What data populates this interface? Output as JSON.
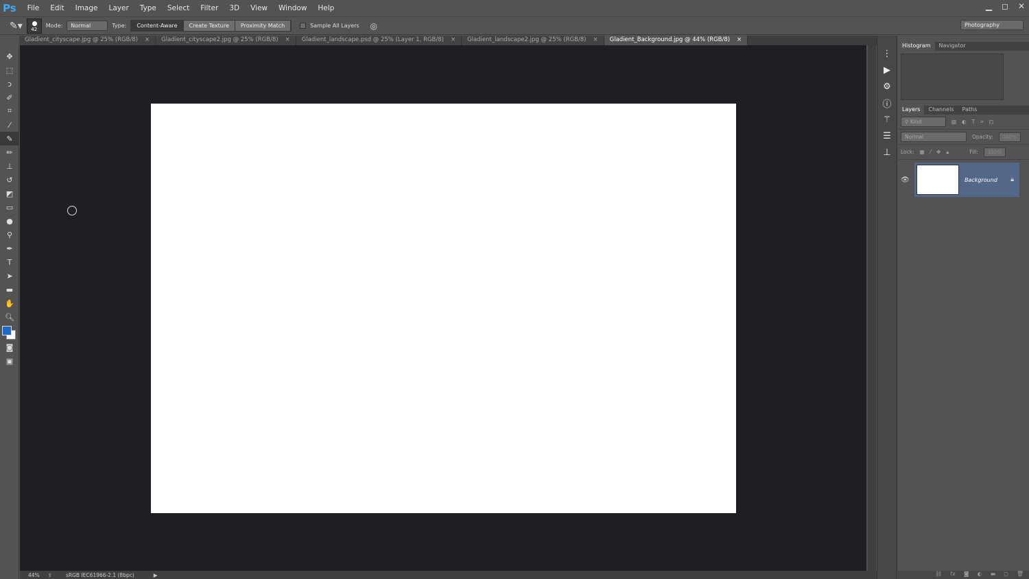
{
  "app": {
    "logo": "Ps"
  },
  "menu": [
    "File",
    "Edit",
    "Image",
    "Layer",
    "Type",
    "Select",
    "Filter",
    "3D",
    "View",
    "Window",
    "Help"
  ],
  "window_controls": {
    "minimize": "▁",
    "restore": "◻",
    "close": "✕"
  },
  "options": {
    "brush_size": "42",
    "mode_label": "Mode:",
    "mode_value": "Normal",
    "type_label": "Type:",
    "types": [
      "Content-Aware",
      "Create Texture",
      "Proximity Match"
    ],
    "active_type": "Content-Aware",
    "sample_all_layers": "Sample All Layers",
    "workspace": "Photography"
  },
  "tabs": [
    {
      "label": "Gladient_cityscape.jpg @ 25% (RGB/8)",
      "active": false
    },
    {
      "label": "Gladient_cityscape2.jpg @ 25% (RGB/8)",
      "active": false
    },
    {
      "label": "Gladient_landscape.psd @ 25% (Layer 1, RGB/8)",
      "active": false
    },
    {
      "label": "Gladient_landscape2.jpg @ 25% (RGB/8)",
      "active": false
    },
    {
      "label": "Gladient_Background.jpg @ 44% (RGB/8)",
      "active": true
    }
  ],
  "tab_close": "×",
  "status": {
    "zoom": "44%",
    "profile": "sRGB IEC61966-2.1 (8bpc)"
  },
  "panels": {
    "top_tabs": [
      "Histogram",
      "Navigator"
    ],
    "layer_tabs": [
      "Layers",
      "Channels",
      "Paths"
    ],
    "filter_kind": "Kind",
    "blend_mode": "Normal",
    "opacity_label": "Opacity:",
    "opacity_value": "100%",
    "lock_label": "Lock:",
    "fill_label": "Fill:",
    "fill_value": "100%",
    "layers": [
      {
        "name": "Background",
        "locked": true,
        "visible": true
      }
    ]
  },
  "colors": {
    "foreground": "#1e6bc7",
    "background": "#ffffff"
  }
}
